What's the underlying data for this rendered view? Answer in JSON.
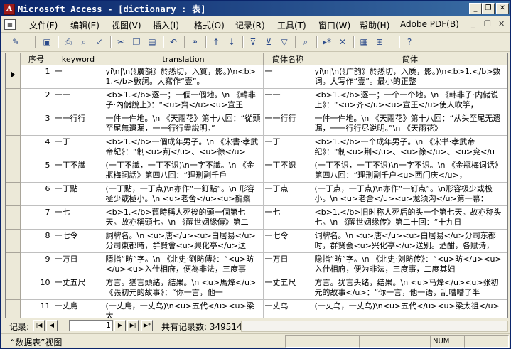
{
  "window": {
    "title": "Microsoft Access - [dictionary : 表]",
    "minimize": "_",
    "restore": "❐",
    "close": "✕"
  },
  "menu": [
    {
      "label": "文件(F)"
    },
    {
      "label": "编辑(E)"
    },
    {
      "label": "视图(V)"
    },
    {
      "label": "插入(I)"
    },
    {
      "label": "格式(O)"
    },
    {
      "label": "记录(R)"
    },
    {
      "label": "工具(T)"
    },
    {
      "label": "窗口(W)"
    },
    {
      "label": "帮助(H)"
    },
    {
      "label": "Adobe PDF(B)"
    }
  ],
  "menu_controls": {
    "minimize": "_",
    "restore": "❐",
    "close": "✕"
  },
  "toolbar_icons": [
    "design-view-icon",
    "save-icon",
    "print-icon",
    "print-preview-icon",
    "spelling-icon",
    "cut-icon",
    "copy-icon",
    "paste-icon",
    "undo-icon",
    "hyperlink-icon",
    "sort-ascending-icon",
    "sort-descending-icon",
    "filter-by-selection-icon",
    "filter-by-form-icon",
    "apply-filter-icon",
    "find-icon",
    "new-record-icon",
    "delete-record-icon",
    "database-window-icon",
    "new-object-icon",
    "help-icon"
  ],
  "columns": [
    "序号",
    "keyword",
    "translation",
    "简体名称",
    "简体"
  ],
  "rows": [
    {
      "id": "1",
      "keyword": "一",
      "translation": "yi\\n|\\n(《廣韻》於悉切，入質，影。)\\n<b>1.</b>數詞。大寫作“壹”。",
      "simp_name": "一",
      "simp": "yi\\n|\\n(《广韵》於悉切，入质，影。)\\n<b>1.</b>数词。大写作“壹”。最小的正整"
    },
    {
      "id": "2",
      "keyword": "一一",
      "translation": "<b>1.</b>逐一；一個一個地。\\n 《韓非子·內儲說上》：“<u>齊</u><u>宣王",
      "simp_name": "一一",
      "simp": "<b>1.</b>逐一；一个一个地。\\n 《韩非子·内储说上》：“<u>齐</u><u>宣王</u>使人吹竽，"
    },
    {
      "id": "3",
      "keyword": "一一行行",
      "translation": "一件一件地。\\n 《天雨花》第十八回：“從頭至尾無遺漏，一一行行盡說明。”",
      "simp_name": "一一行行",
      "simp": "一件一件地。\\n 《天雨花》第十八回：“从头至尾无遗漏，一一行行尽说明。”\\n 《天雨花》"
    },
    {
      "id": "4",
      "keyword": "一丁",
      "translation": "<b>1.</b>一個成年男子。\\n 《宋書·孝武帝紀》：“制<u>荊</u>、<u>徐</u>",
      "simp_name": "一丁",
      "simp": "<b>1.</b>一个成年男子。\\n 《宋书·孝武帝纪》：“制<u>荆</u>、<u>徐</u>、<u>兖</u>、"
    },
    {
      "id": "5",
      "keyword": "一丁不識",
      "translation": "(一丁不識，一丁不识)\\n一字不識。\\n 《金瓶梅詞話》第四八回：“理刑副千戶",
      "simp_name": "一丁不识",
      "simp": "(一丁不识，一丁不识)\\n一字不识。\\n 《金瓶梅词话》第四八回：“理刑副千户<u>西门庆</u>，"
    },
    {
      "id": "6",
      "keyword": "一丁點",
      "translation": "(一丁點，一丁点)\\n亦作“一釘點”。\\n 形容極少或極小。\\n <u>老舍</u><u>龍鬚",
      "simp_name": "一丁点",
      "simp": "(一丁点，一丁点)\\n亦作“一钉点”。\\n形容极少或极小。\\n <u>老舍</u><u>龙须沟</u>第一幕："
    },
    {
      "id": "7",
      "keyword": "一七",
      "translation": "<b>1.</b>舊時稱人死後的頭一個第七天。故亦稱頭七。\\n 《醒世姻緣傳》第二",
      "simp_name": "一七",
      "simp": "<b>1.</b>旧时称人死后的头一个第七天。故亦称头七。\\n 《醒世姻缘传》第二十回：“十九日"
    },
    {
      "id": "8",
      "keyword": "一七令",
      "translation": "詞牌名。\\n <u>唐</u><u>白居易</u>分司東都時，群賢會<u>興化亭</u>送別。酒",
      "simp_name": "一七令",
      "simp": "词牌名。\\n <u>唐</u><u>白居易</u>分司东都时，群贤会<u>兴化亭</u>送别。酒酣，各赋诗，"
    },
    {
      "id": "9",
      "keyword": "一万日",
      "translation": "隱指“昉”字。\\n 《北史·劉昉傳》：“<u>昉</u><u>入仕相府，便為非法，三度事",
      "simp_name": "一万日",
      "simp": "隐指“昉”字。\\n 《北史·刘昉传》：“<u>昉</u><u>入仕相府，便为非法，三度事，二度其妇"
    },
    {
      "id": "10",
      "keyword": "一丈五尺",
      "translation": "方言。猶言頭緒，結果。\\n <u>馬烽</u>《張初元的故事》：“你一言，他一",
      "simp_name": "一丈五尺",
      "simp": "方言。犹言头绪，结果。\\n <u>马烽</u><u>张初元的故事</u>：“你一言，他一语，乱嘈嘈了半"
    },
    {
      "id": "11",
      "keyword": "一丈烏",
      "translation": "(一丈烏，一丈乌)\\n<u>五代</u><u>梁太",
      "simp_name": "一丈乌",
      "simp": "(一丈乌，一丈乌)\\n<u>五代</u><u>梁太祖</u>"
    }
  ],
  "navigation": {
    "label": "记录:",
    "current_record": "1",
    "total_text": "共有记录数: 349514",
    "first": "|◀",
    "prev": "◀",
    "next": "▶",
    "last": "▶|",
    "new": "▶*"
  },
  "status": {
    "left": "“数据表”视图",
    "num": "NUM"
  }
}
